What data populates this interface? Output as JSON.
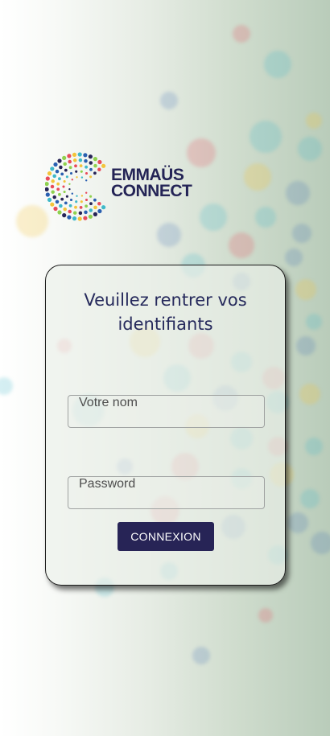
{
  "logo": {
    "line1": "EMMAÜS",
    "line2": "CONNECT"
  },
  "login": {
    "title_line1": "Veuillez rentrer vos",
    "title_line2": "identifiants",
    "name_label": "Votre nom",
    "password_label": "Password",
    "submit_label": "CONNEXION"
  },
  "colors": {
    "brand_navy": "#272456",
    "accent_red": "#e84a5a",
    "accent_yellow": "#f3c43a",
    "accent_teal": "#3fb8c9",
    "accent_blue": "#2a5fb0"
  }
}
